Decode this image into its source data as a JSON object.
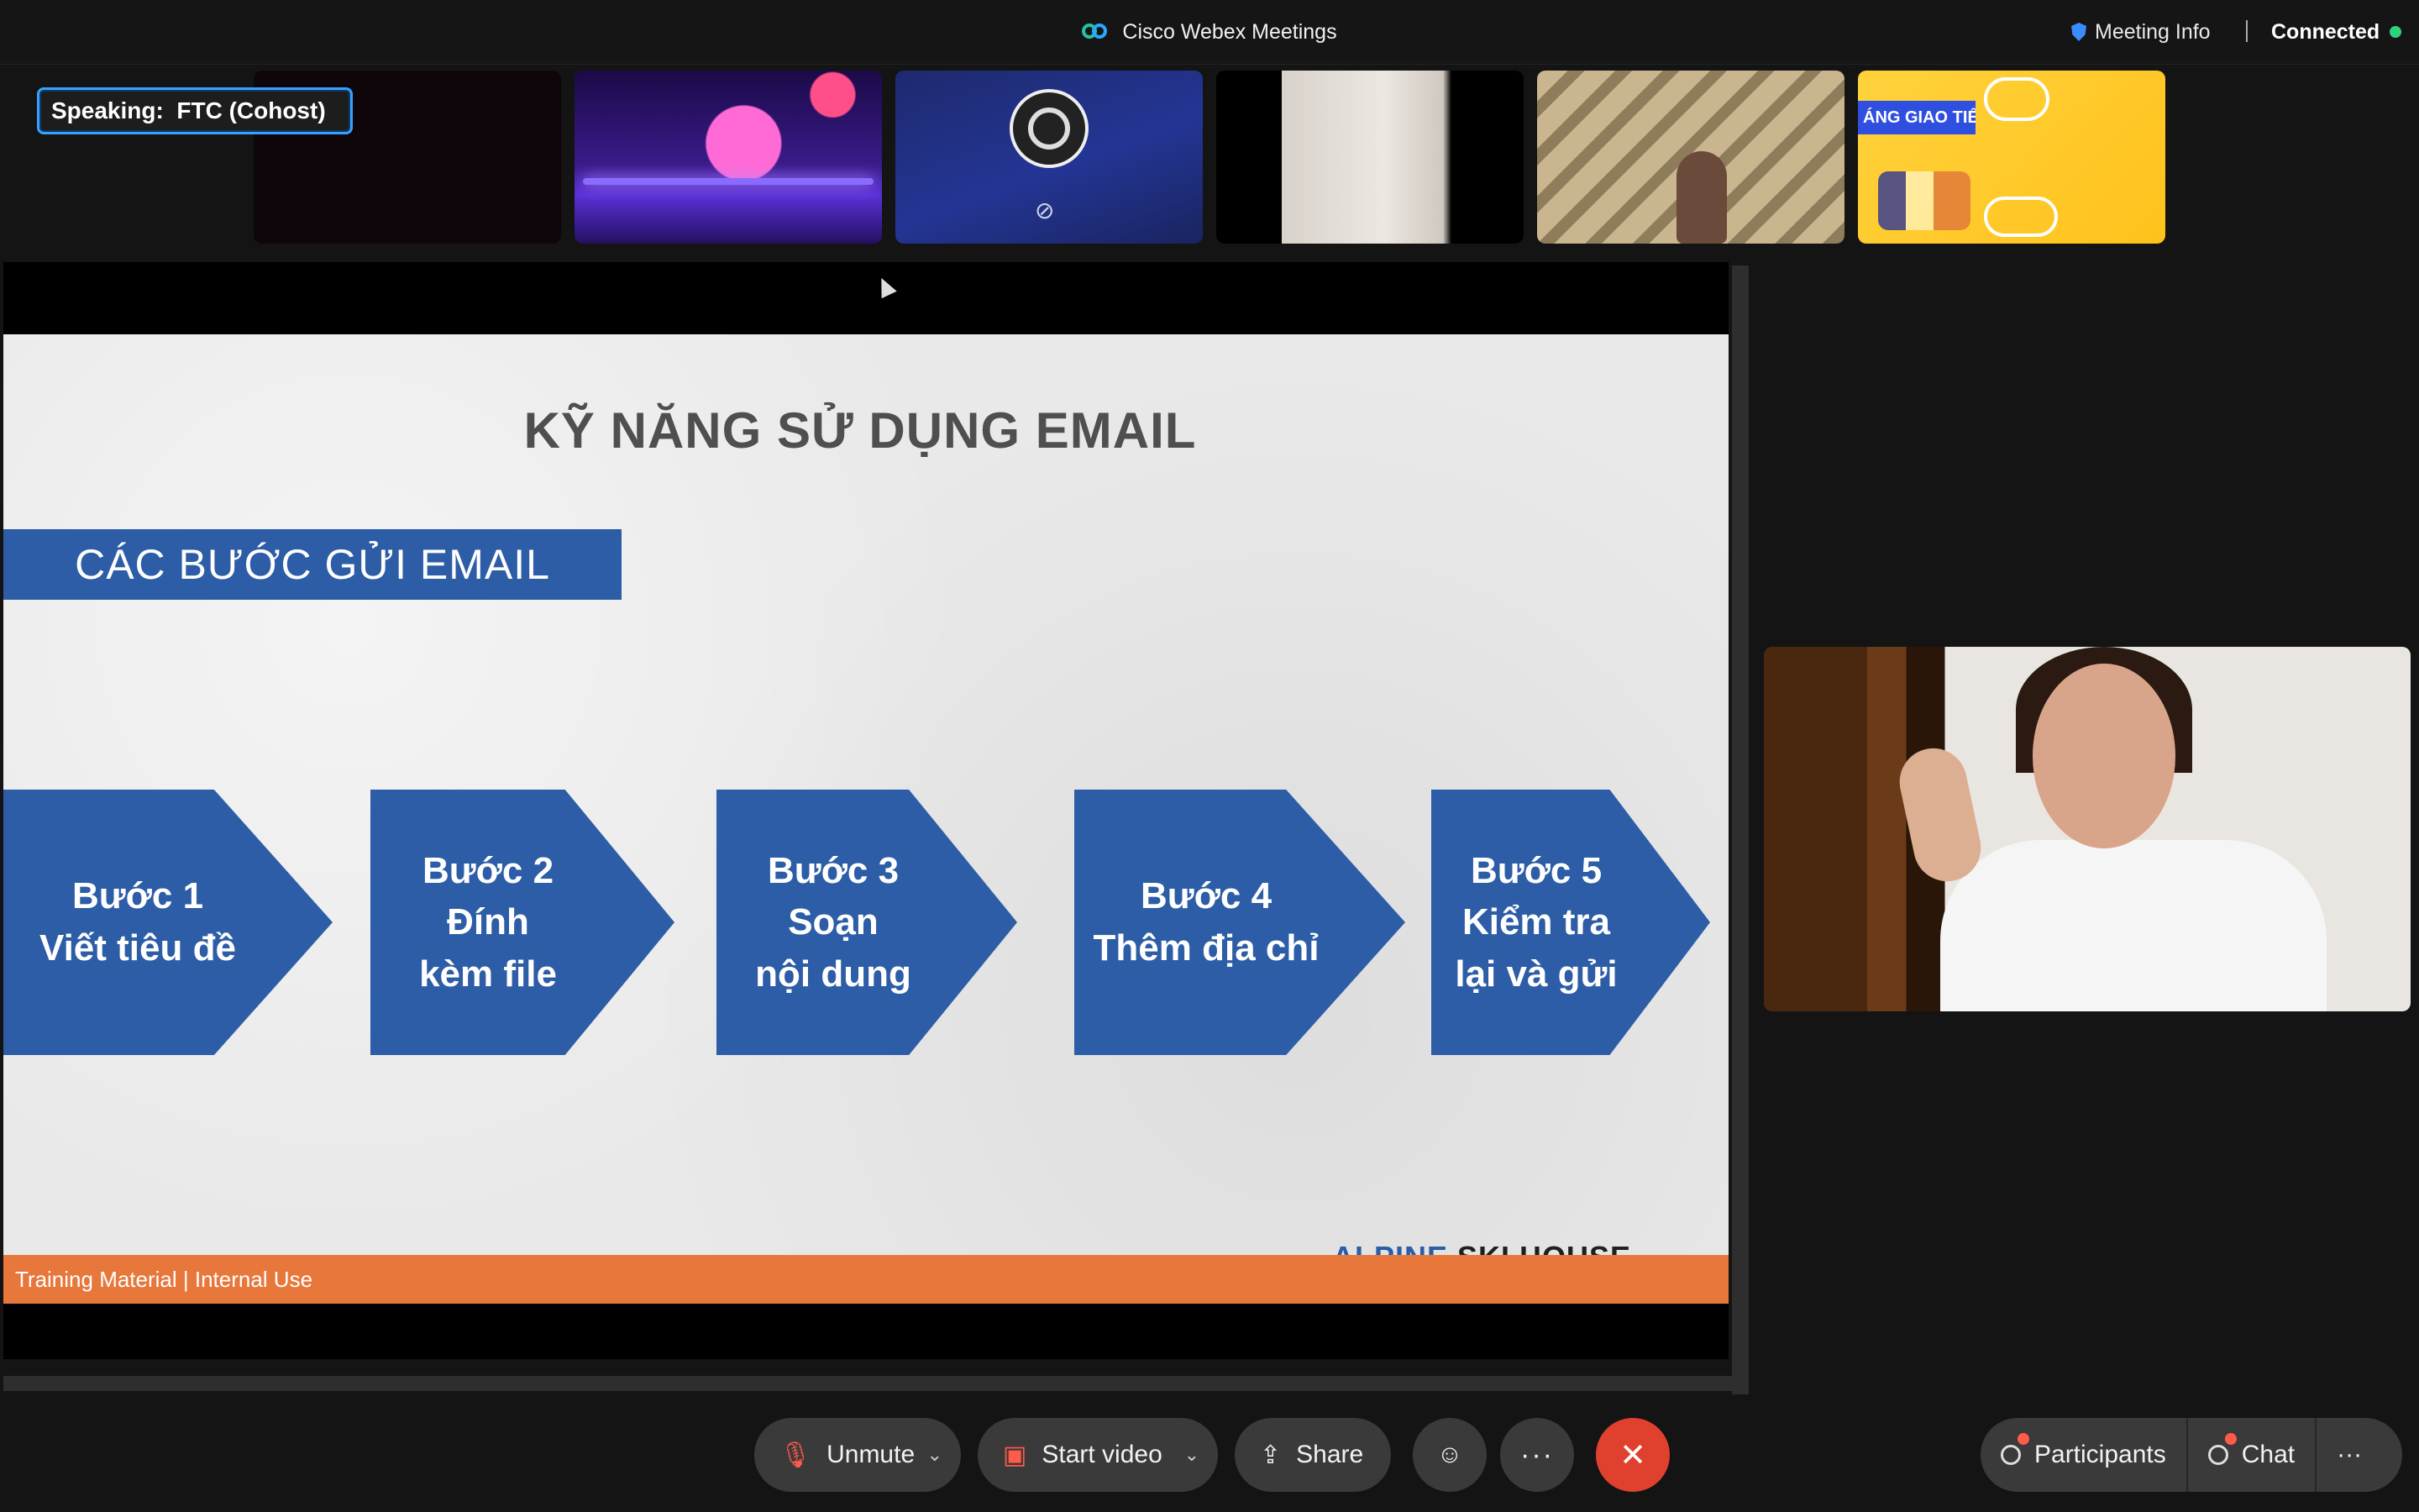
{
  "window": {
    "app_title": "Cisco Webex Meetings",
    "meeting_info": "Meeting Info",
    "status": "Connected",
    "status_color": "#2fd27a"
  },
  "speaking": {
    "text": "Speaking:  FTC (Cohost)"
  },
  "thumbnails": {
    "yellow_banner_text": "ÁNG GIAO TIẾP"
  },
  "slide": {
    "title": "KỸ NĂNG SỬ DỤNG EMAIL",
    "section_label": "CÁC BƯỚC GỬI EMAIL",
    "steps": [
      "Bước 1\nViết tiêu đề",
      "Bước 2\nĐính\nkèm file",
      "Bước 3\nSoạn\nnội dung",
      "Bước 4\nThêm địa chỉ",
      "Bước 5\nKiểm tra\nlại và gửi"
    ],
    "brand_part1": "ALPINE",
    "brand_part2": " SKI HOUSE",
    "footer": "Training Material | Internal Use",
    "accent_color": "#2c5da6",
    "footer_color": "#e8773b"
  },
  "controls": {
    "unmute_label": "Unmute",
    "start_video_label": "Start video",
    "share_label": "Share",
    "more_label": "···",
    "leave_symbol": "✕",
    "participants_label": "Participants",
    "chat_label": "Chat",
    "overflow_label": "···"
  }
}
